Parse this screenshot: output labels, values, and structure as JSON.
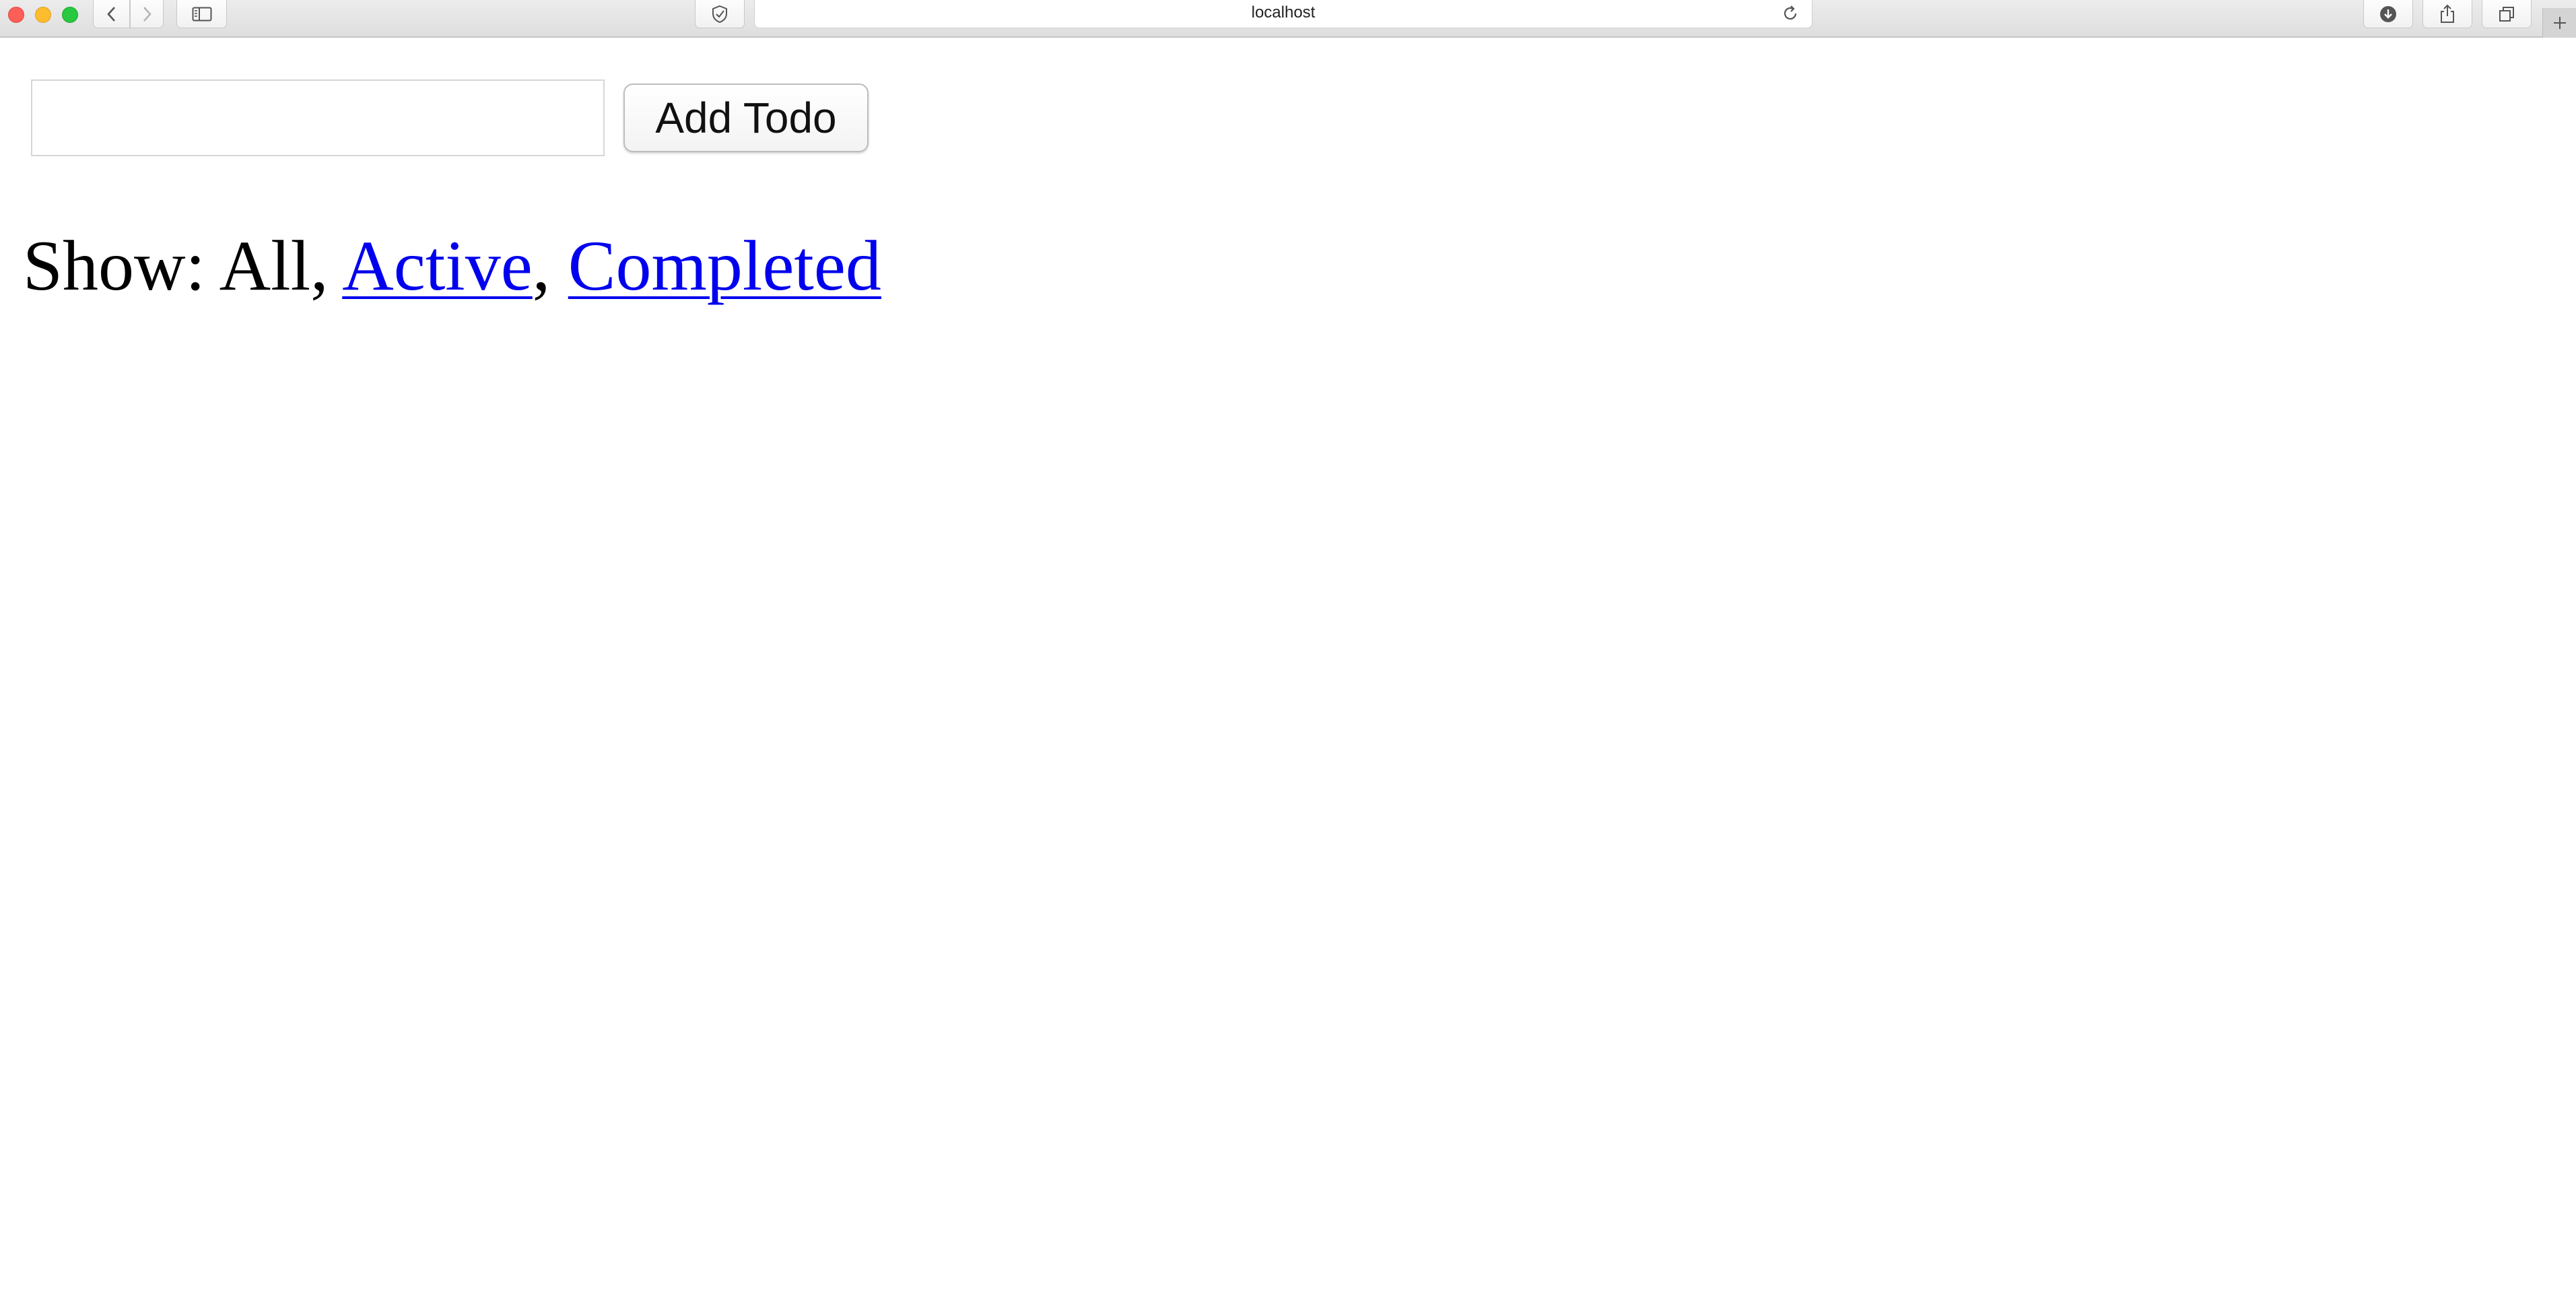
{
  "browser": {
    "url": "localhost",
    "buttons": {
      "back": "chevron-left-icon",
      "forward": "chevron-right-icon",
      "sidebar": "sidebar-icon",
      "privacy": "shield-icon",
      "reload": "reload-icon",
      "downloads": "download-icon",
      "share": "share-icon",
      "tabs": "tabs-icon",
      "new_tab": "plus-icon"
    }
  },
  "todo_form": {
    "input_value": "",
    "input_placeholder": "",
    "add_button_label": "Add Todo"
  },
  "filters": {
    "prefix": "Show:",
    "all_label": "All",
    "active_label": "Active",
    "completed_label": "Completed",
    "separator": ",",
    "selected": "All"
  },
  "colors": {
    "link": "#0000ee",
    "text": "#000000"
  }
}
